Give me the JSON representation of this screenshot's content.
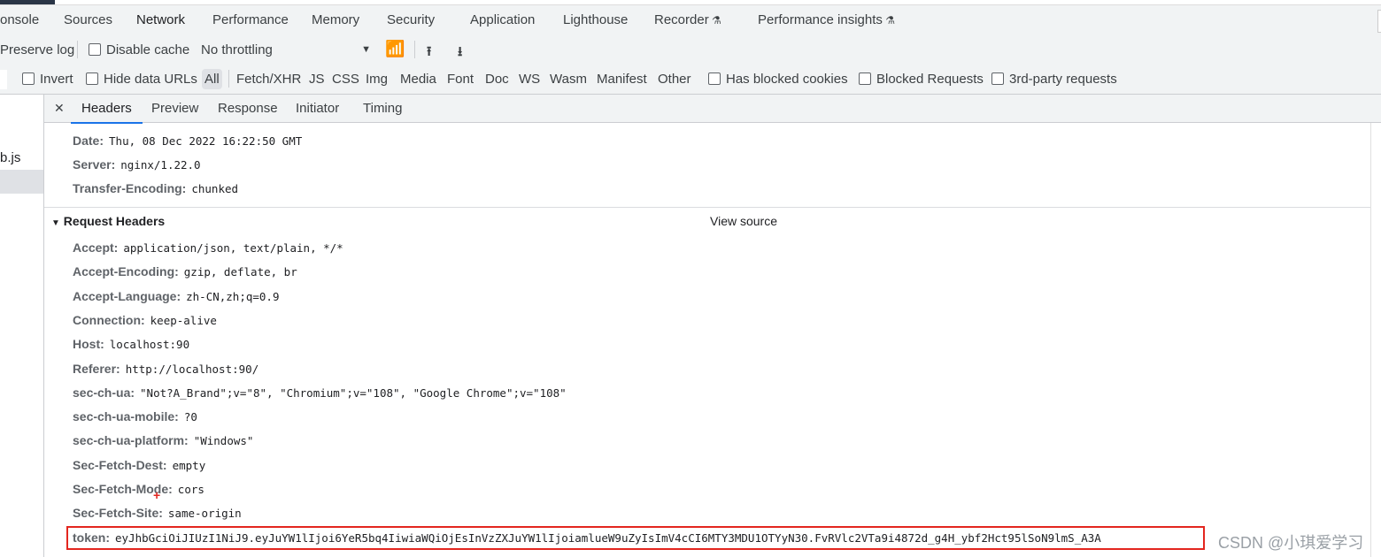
{
  "tabs": [
    "onsole",
    "Sources",
    "Network",
    "Performance",
    "Memory",
    "Security",
    "Application",
    "Lighthouse",
    "Recorder",
    "Performance insights"
  ],
  "active_tab": "Network",
  "toolbar": {
    "preserve_log": "Preserve log",
    "disable_cache": "Disable cache",
    "throttling": "No throttling"
  },
  "filters": {
    "invert": "Invert",
    "hide_data_urls": "Hide data URLs",
    "types": [
      "All",
      "Fetch/XHR",
      "JS",
      "CSS",
      "Img",
      "Media",
      "Font",
      "Doc",
      "WS",
      "Wasm",
      "Manifest",
      "Other"
    ],
    "active_type": "All",
    "has_blocked_cookies": "Has blocked cookies",
    "blocked_requests": "Blocked Requests",
    "third_party": "3rd-party requests"
  },
  "request_list": {
    "file": "b.js"
  },
  "detail_tabs": [
    "Headers",
    "Preview",
    "Response",
    "Initiator",
    "Timing"
  ],
  "active_detail_tab": "Headers",
  "response_headers": [
    {
      "k": "Date:",
      "v": "Thu, 08 Dec 2022 16:22:50 GMT"
    },
    {
      "k": "Server:",
      "v": "nginx/1.22.0"
    },
    {
      "k": "Transfer-Encoding:",
      "v": "chunked"
    }
  ],
  "request_section": {
    "title": "Request Headers",
    "view_source": "View source"
  },
  "request_headers": [
    {
      "k": "Accept:",
      "v": "application/json, text/plain, */*"
    },
    {
      "k": "Accept-Encoding:",
      "v": "gzip, deflate, br"
    },
    {
      "k": "Accept-Language:",
      "v": "zh-CN,zh;q=0.9"
    },
    {
      "k": "Connection:",
      "v": "keep-alive"
    },
    {
      "k": "Host:",
      "v": "localhost:90"
    },
    {
      "k": "Referer:",
      "v": "http://localhost:90/"
    },
    {
      "k": "sec-ch-ua:",
      "v": "\"Not?A_Brand\";v=\"8\", \"Chromium\";v=\"108\", \"Google Chrome\";v=\"108\""
    },
    {
      "k": "sec-ch-ua-mobile:",
      "v": "?0"
    },
    {
      "k": "sec-ch-ua-platform:",
      "v": "\"Windows\""
    },
    {
      "k": "Sec-Fetch-Dest:",
      "v": "empty"
    },
    {
      "k": "Sec-Fetch-Mode:",
      "v": "cors"
    },
    {
      "k": "Sec-Fetch-Site:",
      "v": "same-origin"
    },
    {
      "k": "token:",
      "v": "eyJhbGciOiJIUzI1NiJ9.eyJuYW1lIjoi6YeR5bq4IiwiaWQiOjEsInVzZXJuYW1lIjoiamlueW9uZyIsImV4cCI6MTY3MDU1OTYyN30.FvRVlc2VTa9i4872d_g4H_ybf2Hct95lSoN9lmS_A3A"
    }
  ],
  "watermark": "CSDN @小琪爱学习",
  "colors": {
    "accent": "#1a73e8",
    "highlight_box": "#e3261f"
  }
}
